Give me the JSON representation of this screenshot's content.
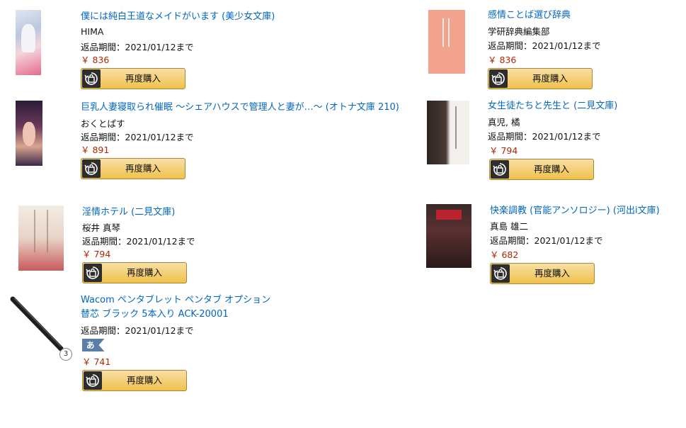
{
  "button_label": "再度購入",
  "items": [
    {
      "title": "僕には純白王道なメイドがいます (美少女文庫)",
      "author": "HIMA",
      "due": "返品期間：2021/01/12まで",
      "price": "￥ 836"
    },
    {
      "title": "巨乳人妻寝取られ催眠 ～シェアハウスで管理人と妻が…～ (オトナ文庫 210)",
      "author": "おくとぱす",
      "due": "返品期間：2021/01/12まで",
      "price": "￥ 891"
    },
    {
      "title": "淫情ホテル (二見文庫)",
      "author": "桜井 真琴",
      "due": "返品期間：2021/01/12まで",
      "price": "￥ 794"
    },
    {
      "title_line1": "Wacom ペンタブレット ペンタブ オプション",
      "title_line2": "替芯 ブラック 5本入り ACK-20001",
      "due": "返品期間：2021/01/12まで",
      "badge": "あわせ買い対象",
      "quantity": "3",
      "price": "￥ 741"
    },
    {
      "title": "感情ことば選び辞典",
      "author": "学研辞典編集部",
      "due": "返品期間：2021/01/12まで",
      "price": "￥ 836"
    },
    {
      "title": "女生徒たちと先生と (二見文庫)",
      "author": "真児, 橘",
      "due": "返品期間：2021/01/12まで",
      "price": "￥ 794"
    },
    {
      "title": "快楽調教 (官能アンソロジー) (河出i文庫)",
      "author": "真島 雄二",
      "due": "返品期間：2021/01/12まで",
      "price": "￥ 682"
    }
  ],
  "colors": {
    "link": "#0066c0",
    "price": "#b12704",
    "button": "#f0c14b",
    "badge": "#5a7ea6"
  }
}
